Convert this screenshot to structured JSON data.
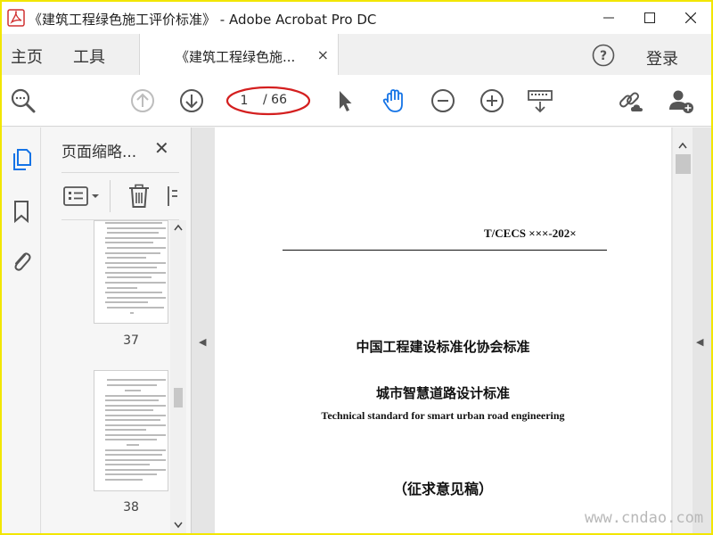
{
  "window": {
    "title": "《建筑工程绿色施工评价标准》 - Adobe Acrobat Pro DC",
    "minimize_icon": "minimize-icon",
    "maximize_icon": "maximize-icon",
    "close_icon": "close-icon"
  },
  "nav": {
    "home_label": "主页",
    "tools_label": "工具",
    "doc_tab_label": "《建筑工程绿色施...",
    "doc_tab_close": "×",
    "sign_in_label": "登录"
  },
  "toolbar": {
    "page_current": "1",
    "page_total": "/ 66",
    "icons": [
      "search-zoom-icon",
      "prev-page-icon",
      "next-page-icon",
      "select-pointer-icon",
      "hand-tool-icon",
      "zoom-out-icon",
      "zoom-in-icon",
      "keyboard-scroll-icon",
      "share-link-icon",
      "add-user-icon"
    ],
    "highlight_color": "#d41f1f",
    "hand_tool_color": "#1473e6"
  },
  "sidebar": {
    "panel_title": "页面缩略...",
    "panel_close": "✕",
    "thumbnails": [
      {
        "page_label": "37"
      },
      {
        "page_label": "38"
      }
    ]
  },
  "document": {
    "standard_code": "T/CECS ×××-202×",
    "organization": "中国工程建设标准化协会标准",
    "title_cn": "城市智慧道路设计标准",
    "title_en": "Technical standard for smart urban road engineering",
    "draft_note": "（征求意见稿）"
  },
  "watermark": "www.cndao.com",
  "frame_color": "#f2e600"
}
